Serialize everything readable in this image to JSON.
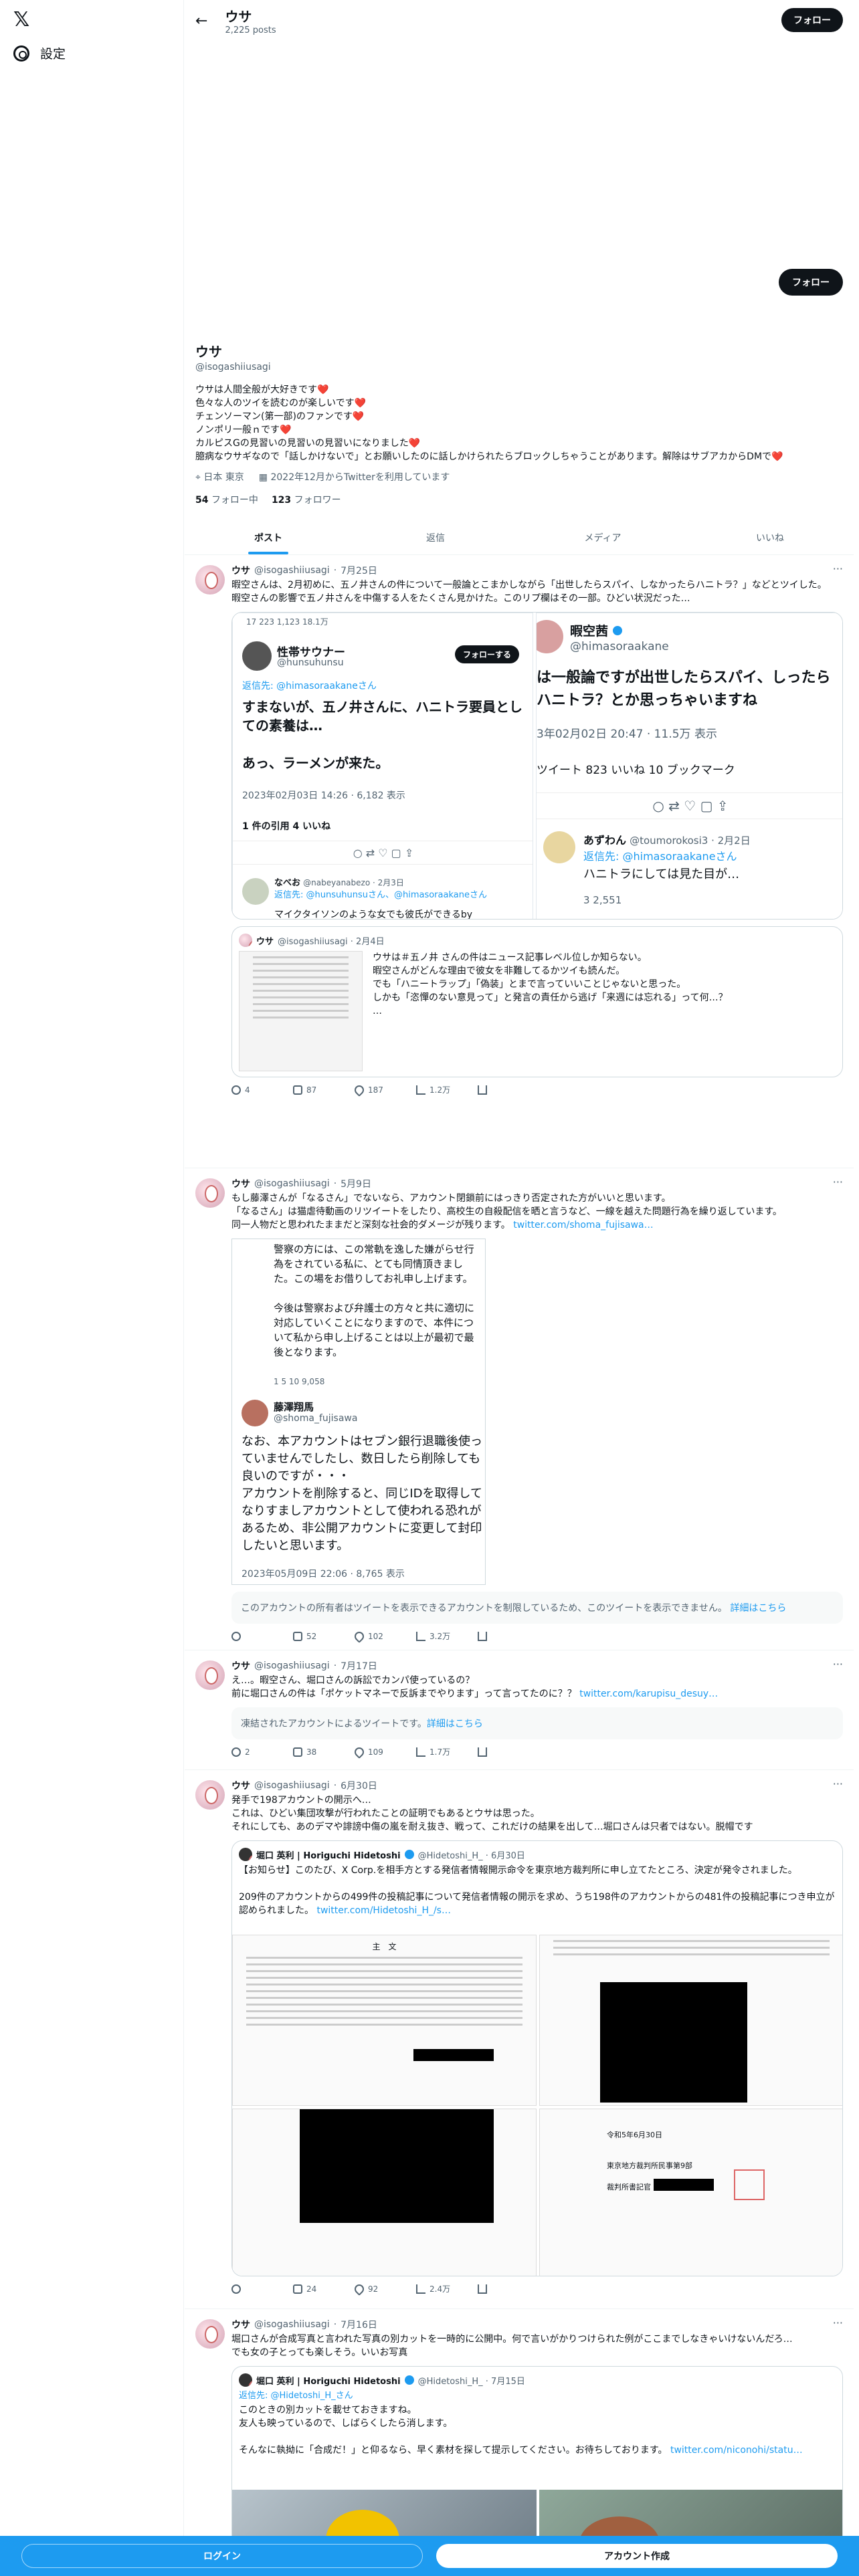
{
  "nav": {
    "settings": "設定"
  },
  "header": {
    "name": "ウサ",
    "posts": "2,225 posts",
    "follow": "フォロー"
  },
  "profile": {
    "name": "ウサ",
    "handle": "@isogashiiusagi",
    "bio": "ウサは人間全般が大好きです❤️\n色々な人のツイを読むのが楽しいです❤️\nチェンソーマン(第一部)のファンです❤️\nノンポリ一般ｎです❤️\nカルピスGの見習いの見習いの見習いになりました❤️\n臆病なウサギなので「話しかけないで」とお願いしたのに話しかけられたらブロックしちゃうことがあります。解除はサブアカからDMで❤️",
    "location": "日本 東京",
    "joined": "2022年12月からTwitterを利用しています",
    "following_count": "54",
    "following_label": "フォロー中",
    "followers_count": "123",
    "followers_label": "フォロワー"
  },
  "tabs": [
    "ポスト",
    "返信",
    "メディア",
    "いいね"
  ],
  "tweets": [
    {
      "name": "ウサ",
      "handle": "@isogashiiusagi",
      "date": "7月25日",
      "text": "暇空さんは、2月初めに、五ノ井さんの件について一般論とこまかしながら「出世したらスパイ、しなかったらハニトラ？」などとツイした。\n暇空さんの影響で五ノ井さんを中傷する人をたくさん見かけた。このリプ欄はその一部。ひどい状況だった…",
      "shot1": {
        "top_stats": "17   223   1,123   18.1万",
        "name": "性帯サウナー",
        "handle": "@hunsuhunsu",
        "follow": "フォローする",
        "reply_to": "返信先: @himasoraakaneさん",
        "body": "すまないが、五ノ井さんに、ハニトラ要員としての素養は…\n\nあっ、ラーメンが来た。",
        "time": "2023年02月03日 14:26 · 6,182 表示",
        "quotes": "1 件の引用  4 いいね",
        "r_name": "なべお",
        "r_handle": "@nabeyanabezo · 2月3日",
        "r_to": "返信先: @hunsuhunsuさん、@himasoraakaneさん",
        "r_body": "マイクタイソンのような女でも彼氏ができるby"
      },
      "shot2": {
        "name": "暇空茜",
        "handle": "@himasoraakane",
        "body": "は一般論ですが出世したらスパイ、しったらハニトラ？とか思っちゃいますね",
        "time": "3年02月02日 20:47 · 11.5万 表示",
        "stats": "ツイート 823 いいね 10 ブックマーク",
        "r_name": "あずわん",
        "r_handle": "@toumorokosi3 · 2月2日",
        "r_to": "返信先: @himasoraakaneさん",
        "r_body": "ハニトラにしては見た目が…",
        "r_stats": "3   2,551"
      },
      "quote": {
        "name": "ウサ",
        "handle": "@isogashiiusagi · 2月4日",
        "text": "ウサは＃五ノ井 さんの件はニュース記事レベル位しか知らない。\n暇空さんがどんな理由で彼女を非難してるかツイも読んだ。\nでも「ハニートラップ」「偽装」とまで言っていいことじゃないと思った。\nしかも「恣憚のない意見って」と発言の責任から逃げ「来週には忘れる」って何…？\n…"
      },
      "actions": [
        "4",
        "87",
        "187",
        "1.2万"
      ]
    },
    {
      "name": "ウサ",
      "handle": "@isogashiiusagi",
      "date": "5月9日",
      "text": "もし藤澤さんが「なるさん」でないなら、アカウント閉鎖前にはっきり否定された方がいいと思います。\n「なるさん」は猫虐待動画のリツイートをしたり、高校生の自殺配信を晒と言うなど、一線を越えた問題行為を繰り返しています。\n同一人物だと思われたままだと深刻な社会的ダメージが残ります。",
      "link": "twitter.com/shoma_fujisawa…",
      "shot": {
        "body1": "警察の方には、この常軌を逸した嫌がらせ行為をされている私に、とても同情頂きました。この場をお借りしてお礼申し上げます。\n\n今後は警察および弁護士の方々と共に適切に対応していくことになりますので、本件について私から申し上げることは以上が最初で最後となります。",
        "stats": "1   5   10   9,058",
        "name": "藤澤翔馬",
        "handle": "@shoma_fujisawa",
        "body2": "なお、本アカウントはセブン銀行退職後使っていませんでしたし、数日したら削除しても良いのですが・・・\nアカウントを削除すると、同じIDを取得してなりすましアカウントとして使われる恐れがあるため、非公開アカウントに変更して封印したいと思います。",
        "time": "2023年05月09日 22:06 · 8,765 表示"
      },
      "restricted": "このアカウントの所有者はツイートを表示できるアカウントを制限しているため、このツイートを表示できません。",
      "restricted_link": "詳細はこちら",
      "actions": [
        "",
        "52",
        "102",
        "3.2万"
      ]
    },
    {
      "name": "ウサ",
      "handle": "@isogashiiusagi",
      "date": "7月17日",
      "text": "え…。暇空さん、堀口さんの訴訟でカンパ使っているの？\n前に堀口さんの件は「ポケットマネーで反訴までやります」って言ってたのに？？",
      "link": "twitter.com/karupisu_desuy…",
      "restricted": "凍結されたアカウントによるツイートです。",
      "restricted_link": "詳細はこちら",
      "actions": [
        "2",
        "38",
        "109",
        "1.7万"
      ]
    },
    {
      "name": "ウサ",
      "handle": "@isogashiiusagi",
      "date": "6月30日",
      "text": "発手で198アカウントの開示へ…\nこれは、ひどい集団攻撃が行われたことの証明でもあるとウサは思った。\nそれにしても、あのデマや誹謗中傷の嵐を耐え抜き、戦って、これだけの結果を出して…堀口さんは只者ではない。脱帽です",
      "quote": {
        "name": "堀口 英利 | Horiguchi Hidetoshi",
        "handle": "@Hidetoshi_H_ · 6月30日",
        "text": "【お知らせ】このたび、X Corp.を相手方とする発信者情報開示命令を東京地方裁判所に申し立てたところ、決定が発令されました。\n\n209件のアカウントからの499件の投稿記事について発信者情報の開示を求め、うち198件のアカウントからの481件の投稿記事につき申立が認められました。",
        "link": "twitter.com/Hidetoshi_H_/s…",
        "doc1": "主　文",
        "doc2": "令和5年6月30日",
        "doc3": "東京地方裁判所民事第9部",
        "doc4": "裁判所書記官"
      },
      "actions": [
        "",
        "24",
        "92",
        "2.4万"
      ]
    },
    {
      "name": "ウサ",
      "handle": "@isogashiiusagi",
      "date": "7月16日",
      "text": "堀口さんが合成写真と言われた写真の別カットを一時的に公開中。何で言いがかりつけられた例がここまでしなきゃいけないんだろ…\nでも女の子とっても楽しそう。いいお写真",
      "quote": {
        "name": "堀口 英利 | Horiguchi Hidetoshi",
        "handle": "@Hidetoshi_H_ · 7月15日",
        "reply_to": "返信先: @Hidetoshi_H_さん",
        "text": "このときの別カットを載せておきますね。\n友人も映っているので、しばらくしたら消します。\n\nそんなに執拗に「合成だ！」と仰るなら、早く素材を探して提示してください。お待ちしております。",
        "link": "twitter.com/niconohi/statu…"
      }
    }
  ],
  "bottom": {
    "login": "ログイン",
    "signup": "アカウント作成"
  }
}
